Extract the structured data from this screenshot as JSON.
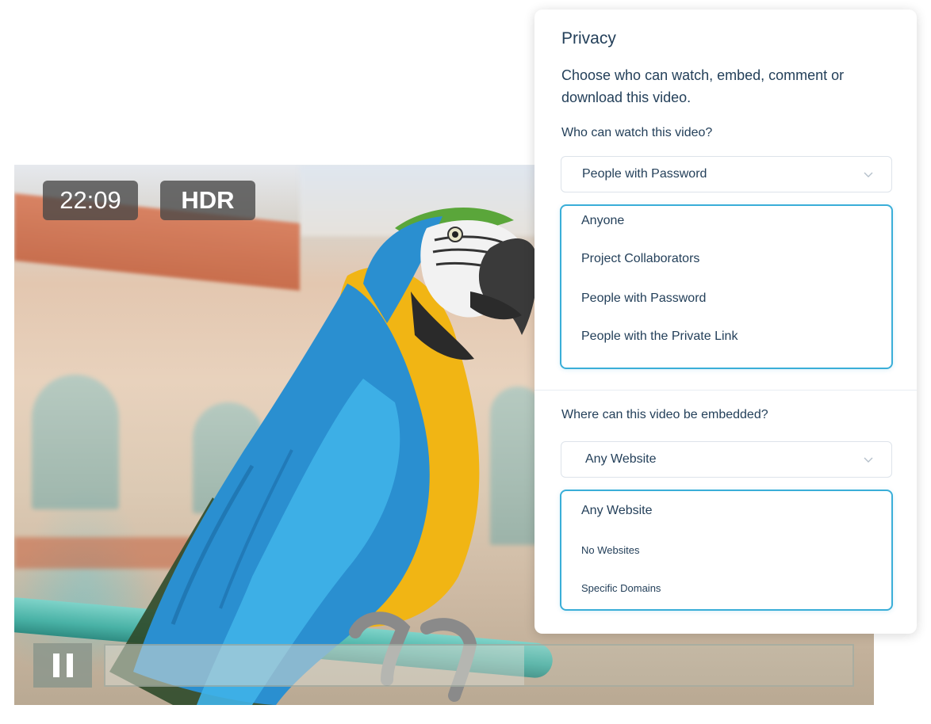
{
  "video": {
    "timestamp": "22:09",
    "quality_badge": "HDR",
    "playback_progress_fraction": 0.56,
    "pause_icon": "pause-icon"
  },
  "privacy": {
    "title": "Privacy",
    "description": "Choose who can watch, embed, comment or download this video.",
    "watch": {
      "label": "Who can watch this video?",
      "selected": "People with Password",
      "options": [
        "Anyone",
        "Project Collaborators",
        "People with Password",
        "People with the Private Link"
      ]
    },
    "embed": {
      "label": "Where can this video be embedded?",
      "selected": "Any Website",
      "options": [
        "Any Website",
        "No Websites",
        "Specific Domains"
      ]
    },
    "chevron_icon": "chevron-down-icon"
  },
  "colors": {
    "accent_border": "#3aaed8",
    "text": "#24405a",
    "perch": "#49b2a6"
  }
}
